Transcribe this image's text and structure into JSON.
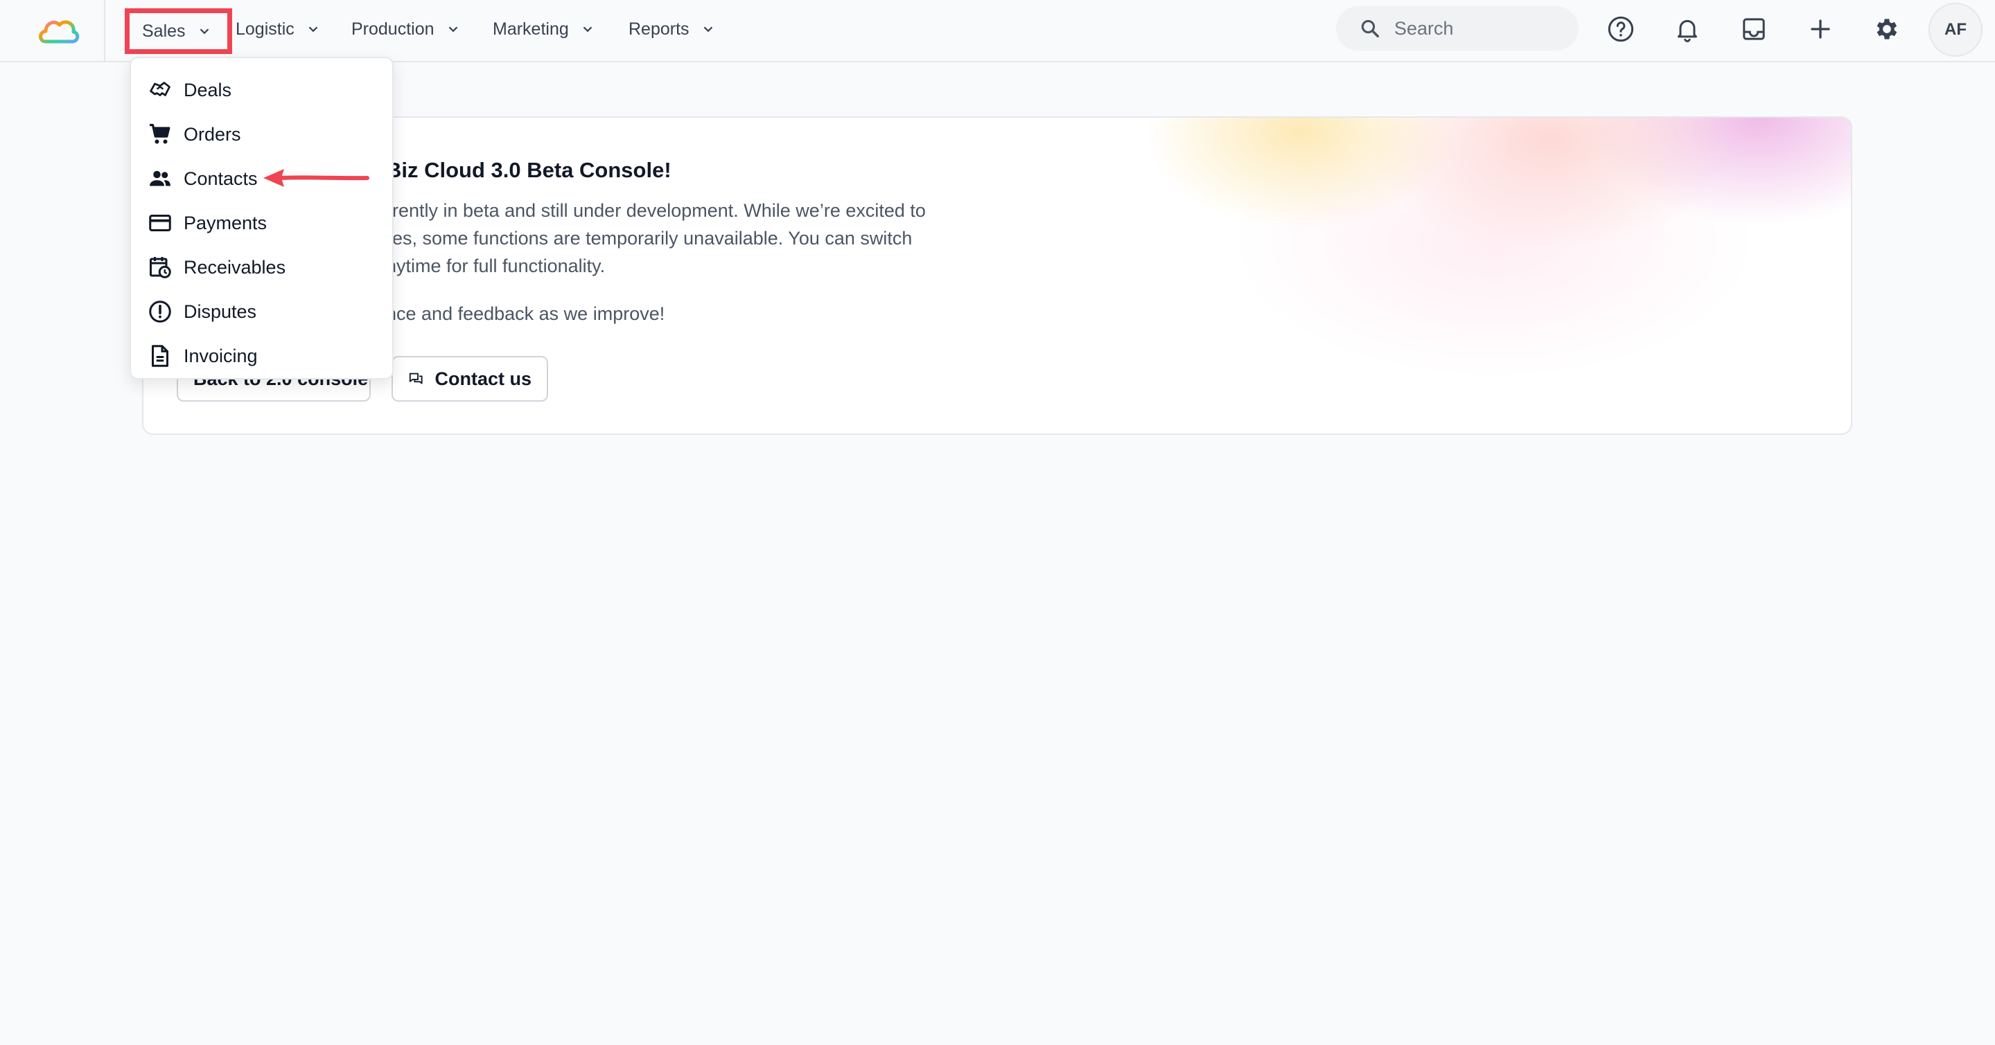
{
  "nav": {
    "items": [
      {
        "label": "Sales"
      },
      {
        "label": "Logistic"
      },
      {
        "label": "Production"
      },
      {
        "label": "Marketing"
      },
      {
        "label": "Reports"
      }
    ]
  },
  "search": {
    "placeholder": "Search"
  },
  "user": {
    "initials": "AF"
  },
  "banner": {
    "title_visible": "Biz Cloud 3.0 Beta Console!",
    "text_line1": "rrently in beta and still under development. While we’re excited to",
    "text_line2": "res, some functions are temporarily unavailable. You can switch",
    "text_line3": "nytime for full functionality.",
    "text_line4": "nce and feedback as we improve!",
    "back_button": "Back to 2.0 console",
    "contact_button": "Contact us"
  },
  "dropdown": {
    "items": [
      {
        "label": "Deals",
        "icon": "handshake-icon"
      },
      {
        "label": "Orders",
        "icon": "cart-icon"
      },
      {
        "label": "Contacts",
        "icon": "people-icon"
      },
      {
        "label": "Payments",
        "icon": "credit-card-icon"
      },
      {
        "label": "Receivables",
        "icon": "calendar-clock-icon"
      },
      {
        "label": "Disputes",
        "icon": "alert-circle-icon"
      },
      {
        "label": "Invoicing",
        "icon": "document-icon"
      }
    ]
  },
  "colors": {
    "highlight": "#ef4452",
    "annotation_arrow": "#ef4452",
    "text": "#111827",
    "muted": "#4b5563"
  }
}
